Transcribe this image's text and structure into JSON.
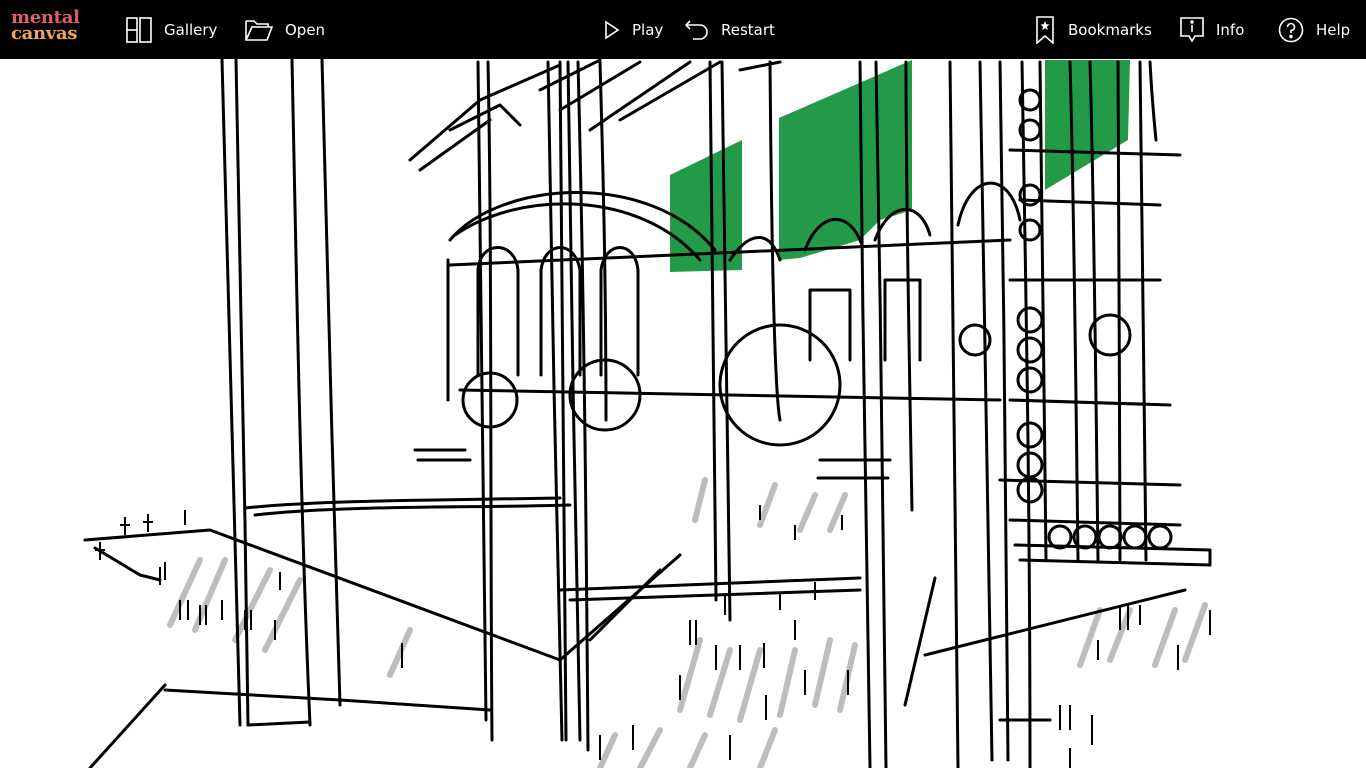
{
  "app": {
    "logo_line1": "mental",
    "logo_line2": "canvas"
  },
  "toolbar": {
    "gallery_label": "Gallery",
    "open_label": "Open",
    "play_label": "Play",
    "restart_label": "Restart",
    "bookmarks_label": "Bookmarks",
    "info_label": "Info",
    "help_label": "Help"
  },
  "icons": {
    "gallery": "gallery-icon",
    "open": "folder-icon",
    "play": "play-icon",
    "restart": "restart-icon",
    "bookmarks": "bookmark-icon",
    "info": "info-icon",
    "help": "help-icon"
  },
  "colors": {
    "toolbar_bg": "#000000",
    "logo_top": "#e15b6e",
    "logo_bottom": "#f0a552",
    "sketch_green": "#239a48",
    "sketch_line": "#000000",
    "shadow": "#bdbdbd"
  }
}
